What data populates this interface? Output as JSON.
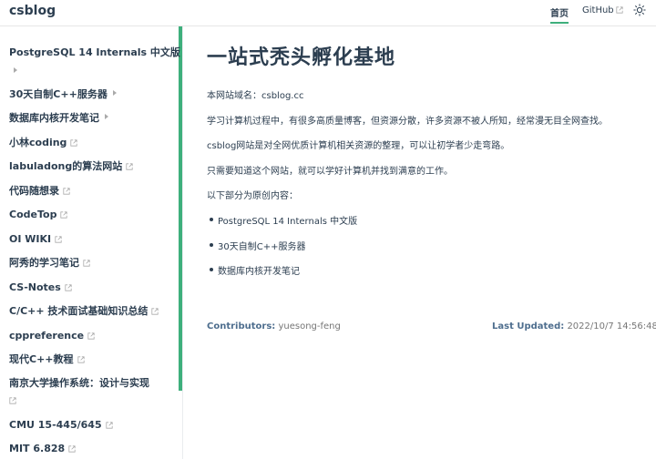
{
  "navbar": {
    "site_name": "csblog",
    "links": [
      {
        "label": "首页"
      },
      {
        "label": "GitHub"
      }
    ]
  },
  "sidebar": {
    "items": [
      {
        "label": "PostgreSQL 14 Internals 中文版",
        "arrow": true,
        "external": false
      },
      {
        "label": "30天自制C++服务器",
        "arrow": true,
        "external": false
      },
      {
        "label": "数据库内核开发笔记",
        "arrow": true,
        "external": false
      },
      {
        "label": "小林coding",
        "arrow": false,
        "external": true
      },
      {
        "label": "labuladong的算法网站",
        "arrow": false,
        "external": true
      },
      {
        "label": "代码随想录",
        "arrow": false,
        "external": true
      },
      {
        "label": "CodeTop",
        "arrow": false,
        "external": true
      },
      {
        "label": "OI WIKI",
        "arrow": false,
        "external": true
      },
      {
        "label": "阿秀的学习笔记",
        "arrow": false,
        "external": true
      },
      {
        "label": "CS-Notes",
        "arrow": false,
        "external": true
      },
      {
        "label": "C/C++ 技术面试基础知识总结",
        "arrow": false,
        "external": true
      },
      {
        "label": "cppreference",
        "arrow": false,
        "external": true
      },
      {
        "label": "现代C++教程",
        "arrow": false,
        "external": true
      },
      {
        "label": "南京大学操作系统：设计与实现",
        "arrow": false,
        "external": true
      },
      {
        "label": "CMU 15-445/645",
        "arrow": false,
        "external": true
      },
      {
        "label": "MIT 6.828",
        "arrow": false,
        "external": true
      }
    ]
  },
  "main": {
    "title": "一站式秃头孵化基地",
    "paragraphs": [
      "本网站域名：csblog.cc",
      "学习计算机过程中，有很多高质量博客，但资源分散，许多资源不被人所知，经常漫无目全网查找。",
      "csblog网站是对全网优质计算机相关资源的整理，可以让初学者少走弯路。",
      "只需要知道这个网站，就可以学好计算机并找到满意的工作。",
      "以下部分为原创内容："
    ],
    "list": [
      "PostgreSQL 14 Internals 中文版",
      "30天自制C++服务器",
      "数据库内核开发笔记"
    ],
    "contributors_label": "Contributors:",
    "contributors_value": "yuesong-feng",
    "updated_label": "Last Updated:",
    "updated_value": "2022/10/7 14:56:48"
  },
  "colors": {
    "accent": "#3eaf7c",
    "text": "#2c3e50"
  }
}
